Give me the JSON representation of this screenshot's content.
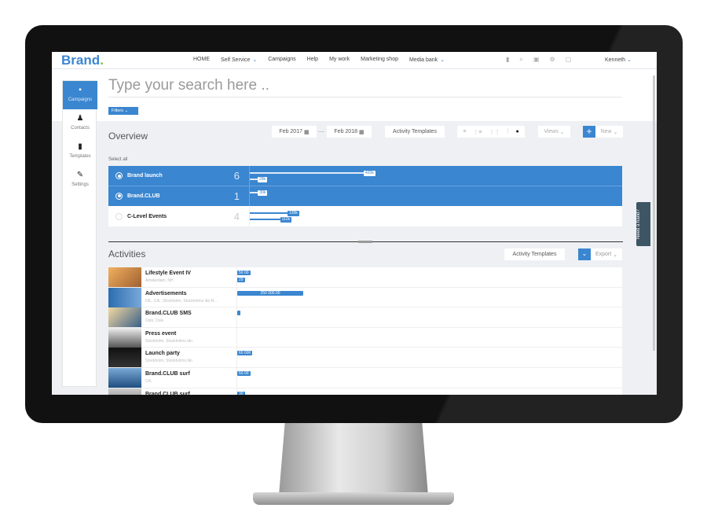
{
  "brand": {
    "name": "Brand",
    "dot": "."
  },
  "nav": [
    {
      "label": "HOME"
    },
    {
      "label": "Self Service",
      "chevron": true
    },
    {
      "label": "Campaigns"
    },
    {
      "label": "Help"
    },
    {
      "label": "My work"
    },
    {
      "label": "Marketing shop"
    },
    {
      "label": "Media bank",
      "chevron": true
    }
  ],
  "top_icons": [
    "document-icon",
    "search-icon",
    "inbox-icon",
    "gear-icon",
    "chat-icon"
  ],
  "user": "Kenneth",
  "sidebar": [
    {
      "label": "Campaigns",
      "icon": "chat-icon",
      "active": true
    },
    {
      "label": "Contacts",
      "icon": "person-icon"
    },
    {
      "label": "Templates",
      "icon": "document-icon"
    },
    {
      "label": "Settings",
      "icon": "wrench-icon"
    }
  ],
  "search": {
    "placeholder": "Type your search here .."
  },
  "filters_label": "Filters",
  "overview": {
    "title": "Overview",
    "date_from": "Feb 2017",
    "date_to": "Feb 2018",
    "templates_label": "Activity Templates",
    "views_label": "Views",
    "new_label": "New",
    "select_all": "Select all",
    "rows": [
      {
        "name": "Brand launch",
        "count": "6",
        "selected": true,
        "bars": [
          {
            "label": "420k",
            "value": 420
          },
          {
            "label": "29k",
            "value": 29
          }
        ]
      },
      {
        "name": "Brand.CLUB",
        "count": "1",
        "selected": true,
        "bars": [
          {
            "label": "30k",
            "value": 30
          }
        ]
      },
      {
        "name": "C-Level Events",
        "count": "4",
        "selected": false,
        "bars": [
          {
            "label": "139k",
            "value": 139
          },
          {
            "label": "112k",
            "value": 112
          }
        ]
      }
    ]
  },
  "activities": {
    "title": "Activities",
    "templates_label": "Activity Templates",
    "export_label": "Export",
    "items": [
      {
        "name": "Lifestyle Event IV",
        "location": "Amsterdam, NH",
        "labels": [
          "50 00",
          "29"
        ]
      },
      {
        "name": "Advertisements",
        "location": "DE, ,CA, ,Stockholm, Stockholms län,N...",
        "labels": [
          "250 000.00"
        ]
      },
      {
        "name": "Brand.CLUB SMS",
        "location": "Oslo, Oslo",
        "labels": [
          ""
        ]
      },
      {
        "name": "Press event",
        "location": "Stockholm, Stockholms län",
        "labels": []
      },
      {
        "name": "Launch party",
        "location": "Stockholm, Stockholms län",
        "labels": [
          "60 000"
        ]
      },
      {
        "name": "Brand.CLUB surf",
        "location": "CA,",
        "labels": [
          "50 00"
        ]
      },
      {
        "name": "Brand.CLUB surf",
        "location": "",
        "labels": [
          "30"
        ]
      }
    ]
  },
  "help_label": "Need a hand?",
  "colors": {
    "accent": "#3a86d0",
    "logo_dot": "#7bbf3a",
    "bezel": "#111111"
  }
}
